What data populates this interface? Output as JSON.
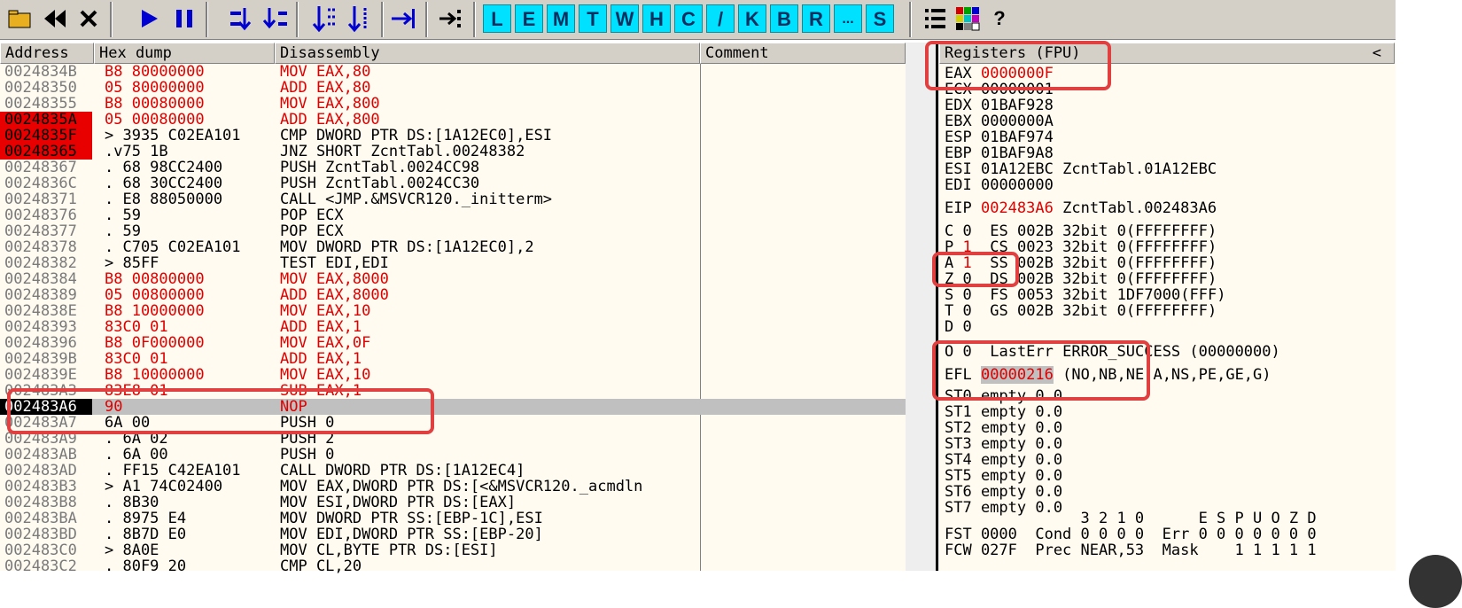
{
  "toolbar": {
    "icons": [
      "open-icon",
      "rewind-icon",
      "close-icon",
      "run-icon",
      "pause-icon",
      "step-into-icon",
      "step-over-icon",
      "trace-into-icon",
      "trace-over-icon",
      "execute-till-return-icon",
      "go-to-icon"
    ],
    "letters": [
      "L",
      "E",
      "M",
      "T",
      "W",
      "H",
      "C",
      "/",
      "K",
      "B",
      "R",
      "...",
      "S"
    ],
    "tail_icons": [
      "list-icon",
      "grid-icon",
      "help-icon"
    ],
    "help_label": "?"
  },
  "headers": {
    "address": "Address",
    "hexdump": "Hex dump",
    "disasm": "Disassembly",
    "comment": "Comment",
    "registers": "Registers (FPU)",
    "collapse": "<"
  },
  "rows": [
    {
      "addr": "0024834B",
      "hex": "B8 80000000",
      "asm": "MOV EAX,80",
      "mark": "",
      "red": true
    },
    {
      "addr": "00248350",
      "hex": "05 80000000",
      "asm": "ADD EAX,80",
      "mark": "",
      "red": true
    },
    {
      "addr": "00248355",
      "hex": "B8 00080000",
      "asm": "MOV EAX,800",
      "mark": "",
      "red": true
    },
    {
      "addr": "0024835A",
      "hex": "05 00080000",
      "asm": "ADD EAX,800",
      "mark": "brk",
      "red": true
    },
    {
      "addr": "0024835F",
      "hex": "> 3935 C02EA101",
      "asm": "CMP DWORD PTR DS:[1A12EC0],ESI",
      "mark": "brk",
      "red": false
    },
    {
      "addr": "00248365",
      "hex": ".v75 1B",
      "asm": "JNZ SHORT ZcntTabl.00248382",
      "mark": "brk",
      "red": false
    },
    {
      "addr": "00248367",
      "hex": ". 68 98CC2400",
      "asm": "PUSH ZcntTabl.0024CC98",
      "mark": "",
      "red": false
    },
    {
      "addr": "0024836C",
      "hex": ". 68 30CC2400",
      "asm": "PUSH ZcntTabl.0024CC30",
      "mark": "",
      "red": false
    },
    {
      "addr": "00248371",
      "hex": ". E8 88050000",
      "asm": "CALL <JMP.&MSVCR120._initterm>",
      "mark": "",
      "red": false
    },
    {
      "addr": "00248376",
      "hex": ". 59",
      "asm": "POP ECX",
      "mark": "",
      "red": false
    },
    {
      "addr": "00248377",
      "hex": ". 59",
      "asm": "POP ECX",
      "mark": "",
      "red": false
    },
    {
      "addr": "00248378",
      "hex": ". C705 C02EA101",
      "asm": "MOV DWORD PTR DS:[1A12EC0],2",
      "mark": "",
      "red": false
    },
    {
      "addr": "00248382",
      "hex": "> 85FF",
      "asm": "TEST EDI,EDI",
      "mark": "",
      "red": false
    },
    {
      "addr": "00248384",
      "hex": "B8 00800000",
      "asm": "MOV EAX,8000",
      "mark": "",
      "red": true
    },
    {
      "addr": "00248389",
      "hex": "05 00800000",
      "asm": "ADD EAX,8000",
      "mark": "",
      "red": true
    },
    {
      "addr": "0024838E",
      "hex": "B8 10000000",
      "asm": "MOV EAX,10",
      "mark": "",
      "red": true
    },
    {
      "addr": "00248393",
      "hex": "83C0 01",
      "asm": "ADD EAX,1",
      "mark": "",
      "red": true
    },
    {
      "addr": "00248396",
      "hex": "B8 0F000000",
      "asm": "MOV EAX,0F",
      "mark": "",
      "red": true
    },
    {
      "addr": "0024839B",
      "hex": "83C0 01",
      "asm": "ADD EAX,1",
      "mark": "",
      "red": true
    },
    {
      "addr": "0024839E",
      "hex": "B8 10000000",
      "asm": "MOV EAX,10",
      "mark": "",
      "red": true
    },
    {
      "addr": "002483A3",
      "hex": "83E8 01",
      "asm": "SUB EAX,1",
      "mark": "",
      "red": true
    },
    {
      "addr": "002483A6",
      "hex": "90",
      "asm": "NOP",
      "mark": "cur",
      "red": true
    },
    {
      "addr": "002483A7",
      "hex": "6A 00",
      "asm": "PUSH 0",
      "mark": "",
      "red": false
    },
    {
      "addr": "002483A9",
      "hex": ". 6A 02",
      "asm": "PUSH 2",
      "mark": "",
      "red": false
    },
    {
      "addr": "002483AB",
      "hex": ". 6A 00",
      "asm": "PUSH 0",
      "mark": "",
      "red": false
    },
    {
      "addr": "002483AD",
      "hex": ". FF15 C42EA101",
      "asm": "CALL DWORD PTR DS:[1A12EC4]",
      "mark": "",
      "red": false
    },
    {
      "addr": "002483B3",
      "hex": "> A1 74C02400",
      "asm": "MOV EAX,DWORD PTR DS:[<&MSVCR120._acmdln",
      "mark": "",
      "red": false
    },
    {
      "addr": "002483B8",
      "hex": ". 8B30",
      "asm": "MOV ESI,DWORD PTR DS:[EAX]",
      "mark": "",
      "red": false
    },
    {
      "addr": "002483BA",
      "hex": ". 8975 E4",
      "asm": "MOV DWORD PTR SS:[EBP-1C],ESI",
      "mark": "",
      "red": false
    },
    {
      "addr": "002483BD",
      "hex": ". 8B7D E0",
      "asm": "MOV EDI,DWORD PTR SS:[EBP-20]",
      "mark": "",
      "red": false
    },
    {
      "addr": "002483C0",
      "hex": "> 8A0E",
      "asm": "MOV CL,BYTE PTR DS:[ESI]",
      "mark": "",
      "red": false
    },
    {
      "addr": "002483C2",
      "hex": ". 80F9 20",
      "asm": "CMP CL,20",
      "mark": "",
      "red": false
    }
  ],
  "registers": {
    "eax": {
      "name": "EAX",
      "value": "0000000F"
    },
    "ecx": {
      "name": "ECX",
      "value": "00000001"
    },
    "edx": {
      "name": "EDX",
      "value": "01BAF928"
    },
    "ebx": {
      "name": "EBX",
      "value": "0000000A"
    },
    "esp": {
      "name": "ESP",
      "value": "01BAF974"
    },
    "ebp": {
      "name": "EBP",
      "value": "01BAF9A8"
    },
    "esi": {
      "name": "ESI",
      "value": "01A12EBC",
      "note": "ZcntTabl.01A12EBC"
    },
    "edi": {
      "name": "EDI",
      "value": "00000000"
    },
    "eip": {
      "name": "EIP",
      "value": "002483A6",
      "note": "ZcntTabl.002483A6"
    },
    "flags": [
      {
        "f": "C",
        "v": "0",
        "seg": "ES",
        "sel": "002B",
        "bits": "32bit",
        "lim": "0(FFFFFFFF)"
      },
      {
        "f": "P",
        "v": "1",
        "seg": "CS",
        "sel": "0023",
        "bits": "32bit",
        "lim": "0(FFFFFFFF)"
      },
      {
        "f": "A",
        "v": "1",
        "seg": "SS",
        "sel": "002B",
        "bits": "32bit",
        "lim": "0(FFFFFFFF)"
      },
      {
        "f": "Z",
        "v": "0",
        "seg": "DS",
        "sel": "002B",
        "bits": "32bit",
        "lim": "0(FFFFFFFF)"
      },
      {
        "f": "S",
        "v": "0",
        "seg": "FS",
        "sel": "0053",
        "bits": "32bit",
        "lim": "1DF7000(FFF)"
      },
      {
        "f": "T",
        "v": "0",
        "seg": "GS",
        "sel": "002B",
        "bits": "32bit",
        "lim": "0(FFFFFFFF)"
      },
      {
        "f": "D",
        "v": "0",
        "seg": "",
        "sel": "",
        "bits": "",
        "lim": ""
      }
    ],
    "lasterr": {
      "f": "O",
      "v": "0",
      "text": "LastErr ERROR_SUCCESS (00000000)"
    },
    "efl": {
      "name": "EFL",
      "value": "00000216",
      "note": "(NO,NB,NE,A,NS,PE,GE,G)"
    },
    "st": [
      "ST0 empty 0.0",
      "ST1 empty 0.0",
      "ST2 empty 0.0",
      "ST3 empty 0.0",
      "ST4 empty 0.0",
      "ST5 empty 0.0",
      "ST6 empty 0.0",
      "ST7 empty 0.0"
    ],
    "fpu_header": "               3 2 1 0      E S P U O Z D",
    "fst": "FST 0000  Cond 0 0 0 0  Err 0 0 0 0 0 0 0",
    "fcw": "FCW 027F  Prec NEAR,53  Mask    1 1 1 1 1"
  },
  "colors": {
    "accent_red": "#e00000",
    "highlight_box": "#e04040",
    "toolbar_letter_bg": "#00e0ff",
    "pane_bg": "#fffbf0"
  }
}
